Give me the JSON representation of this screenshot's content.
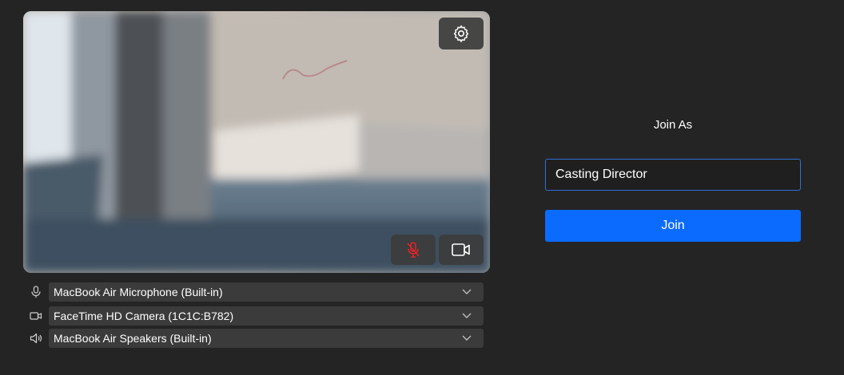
{
  "preview": {
    "settings_icon": "gear-icon",
    "mic_icon": "microphone-muted-icon",
    "mic_icon_color": "#e0242a",
    "camera_icon": "video-camera-icon"
  },
  "devices": {
    "microphone": {
      "icon": "microphone-icon",
      "selected": "MacBook Air Microphone (Built-in)"
    },
    "camera": {
      "icon": "camera-icon",
      "selected": "FaceTime HD Camera (1C1C:B782)"
    },
    "speaker": {
      "icon": "speaker-icon",
      "selected": "MacBook Air Speakers (Built-in)"
    }
  },
  "join": {
    "title": "Join As",
    "name_value": "Casting Director",
    "button_label": "Join",
    "accent": "#0b6bff"
  }
}
